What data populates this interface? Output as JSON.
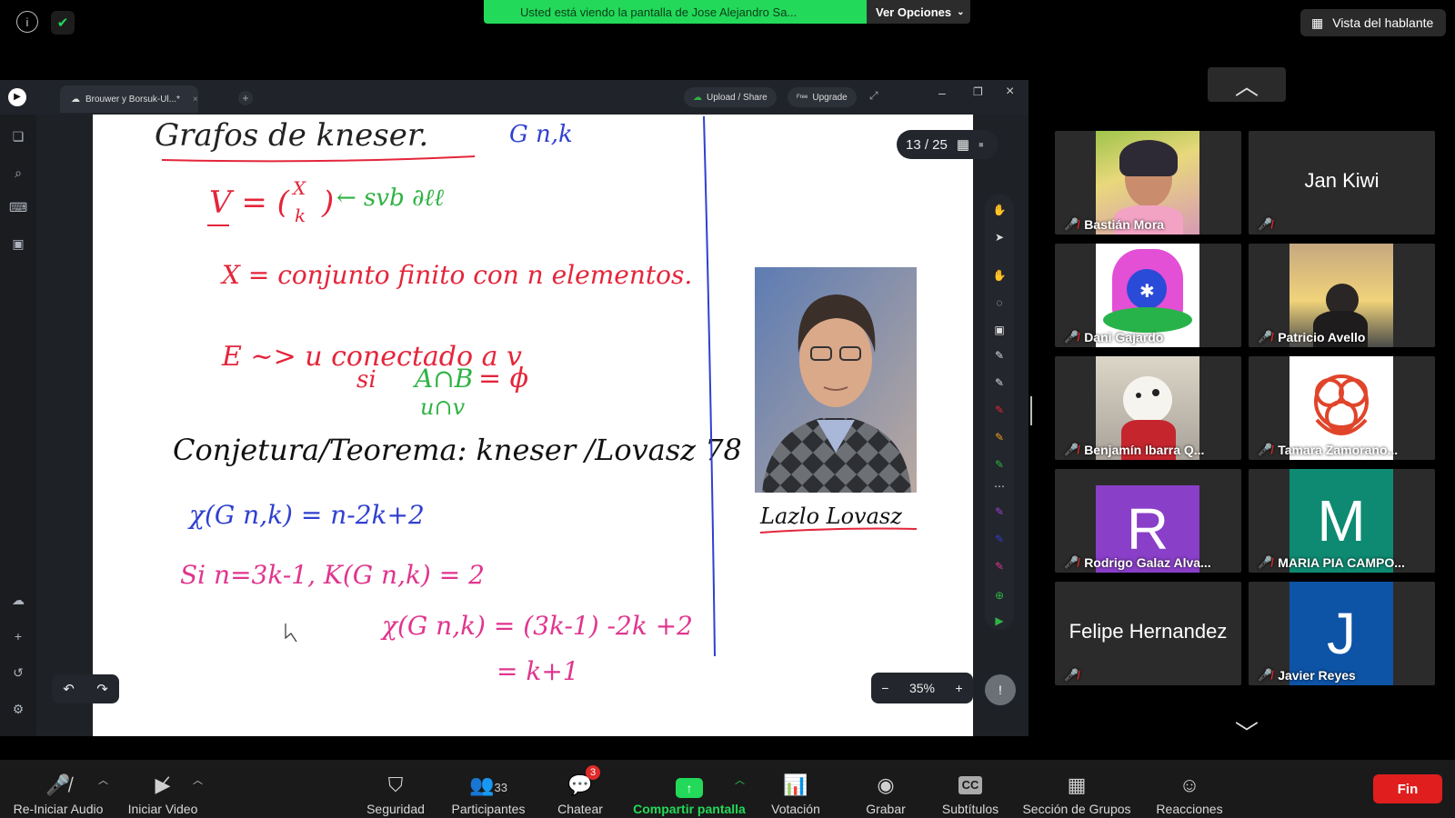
{
  "top_bar": {
    "info_icon": "info-icon",
    "security_icon": "shield-check-icon",
    "share_banner": "Usted está viendo la pantalla de Jose Alejandro Sa...",
    "view_options": "Ver Opciones",
    "speaker_view": "Vista del hablante"
  },
  "app": {
    "tab_title": "Brouwer y Borsuk-Ul...*",
    "upload_share": "Upload / Share",
    "upgrade_badge": "Free",
    "upgrade": "Upgrade",
    "page_indicator": "13 / 25",
    "zoom_level": "35%"
  },
  "whiteboard": {
    "title": "Grafos de kneser.",
    "title_sub": "G n,k",
    "line_v": "V = ( X k ) ← svb X",
    "line_x": "X = conjunto finito con n elementos.",
    "line_e": "E ~> u conectado a v",
    "line_si": "si A∩B = ϕ",
    "line_vnv": "u∩v",
    "line_conj": "Conjetura/Teorema: kneser /Lovasz 78",
    "line_chi": "χ(G n,k) = n-2k+2",
    "line_si2": "Si n=3k-1,  K(G n,k) = 2",
    "line_chi2": "χ(G n,k) = (3k-1) -2k +2",
    "line_eq": "= k+1",
    "photo_caption": "Lazlo Lovasz"
  },
  "gallery": {
    "participants": [
      {
        "name": "Bastián Mora",
        "muted": true,
        "kind": "photo"
      },
      {
        "name": "",
        "big_name": "Jan Kiwi",
        "muted": true,
        "kind": "name"
      },
      {
        "name": "Dani Gajardo",
        "muted": true,
        "kind": "photo"
      },
      {
        "name": "Patricio Avello",
        "muted": true,
        "kind": "photo"
      },
      {
        "name": "Benjamín Ibarra Q...",
        "muted": true,
        "kind": "photo"
      },
      {
        "name": "Tamara Zamorano...",
        "muted": true,
        "kind": "photo"
      },
      {
        "name": "Rodrigo Galaz Alva...",
        "muted": true,
        "kind": "letter",
        "letter": "R",
        "color": "#8a3fc8"
      },
      {
        "name": "MARIA PIA CAMPO...",
        "muted": true,
        "kind": "letter",
        "letter": "M",
        "color": "#0e8a72"
      },
      {
        "name": "",
        "big_name": "Felipe Hernandez",
        "muted": true,
        "kind": "name"
      },
      {
        "name": "Javier Reyes",
        "muted": true,
        "kind": "letter",
        "letter": "J",
        "color": "#0d53a6"
      }
    ]
  },
  "toolbar": {
    "audio": "Re-Iniciar Audio",
    "video": "Iniciar Video",
    "security": "Seguridad",
    "participants": "Participantes",
    "participants_count": "33",
    "chat": "Chatear",
    "chat_badge": "3",
    "share": "Compartir pantalla",
    "poll": "Votación",
    "record": "Grabar",
    "subtitles": "Subtítulos",
    "breakout": "Sección de Grupos",
    "reactions": "Reacciones",
    "end": "Fin"
  },
  "colors": {
    "share_green": "#23d959",
    "end_red": "#e01e1e",
    "ink_red": "#e4253a",
    "ink_green": "#2fb344",
    "ink_blue": "#3040d0",
    "ink_magenta": "#e0358e"
  }
}
